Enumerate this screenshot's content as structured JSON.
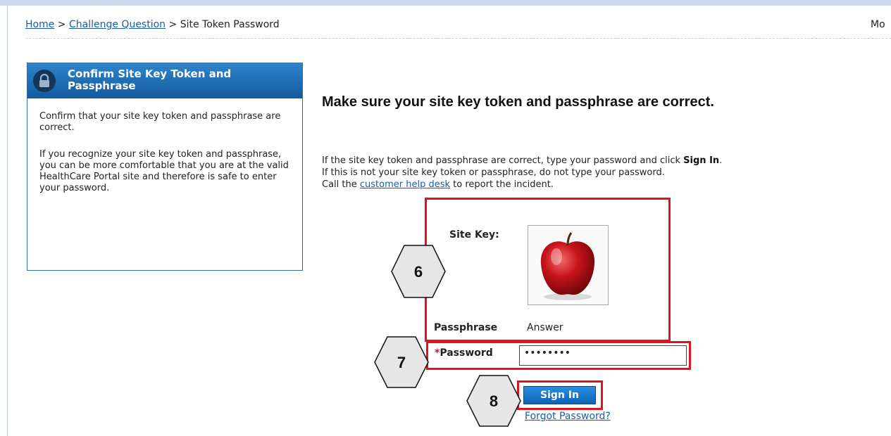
{
  "breadcrumb": {
    "home": "Home",
    "sep1": ">",
    "challenge": "Challenge Question",
    "sep2": ">",
    "current": "Site Token Password"
  },
  "header_cut_text": "Mo",
  "sidebar": {
    "title": "Confirm Site Key Token and Passphrase",
    "para1": "Confirm that your site key token and passphrase are correct.",
    "para2": "If you recognize your site key token and passphrase, you can be more comfortable that you are at the valid HealthCare Portal site and therefore is safe to enter your password."
  },
  "main": {
    "headline": "Make sure your site key token and passphrase are correct.",
    "line1_pre": "If the site key token and passphrase are correct, type your password and click",
    "line1_bold": "Sign In",
    "line1_post": ".",
    "line2": "If this is not your site key token or passphrase, do not type your password.",
    "line3_pre": "Call the",
    "line3_link": "customer help desk",
    "line3_post": "to report the incident."
  },
  "form": {
    "site_key_label": "Site Key:",
    "passphrase_label": "Passphrase",
    "passphrase_value": "Answer",
    "password_required": "*",
    "password_label": "Password",
    "password_value": "••••••••",
    "signin_label": "Sign In",
    "forgot_label": "Forgot Password?"
  },
  "callouts": [
    "6",
    "7",
    "8"
  ],
  "colors": {
    "highlight": "#e0141e",
    "header_blue": "#135a9c",
    "link": "#1a5ea8"
  },
  "icons": [
    "lock-icon",
    "apple-image"
  ]
}
